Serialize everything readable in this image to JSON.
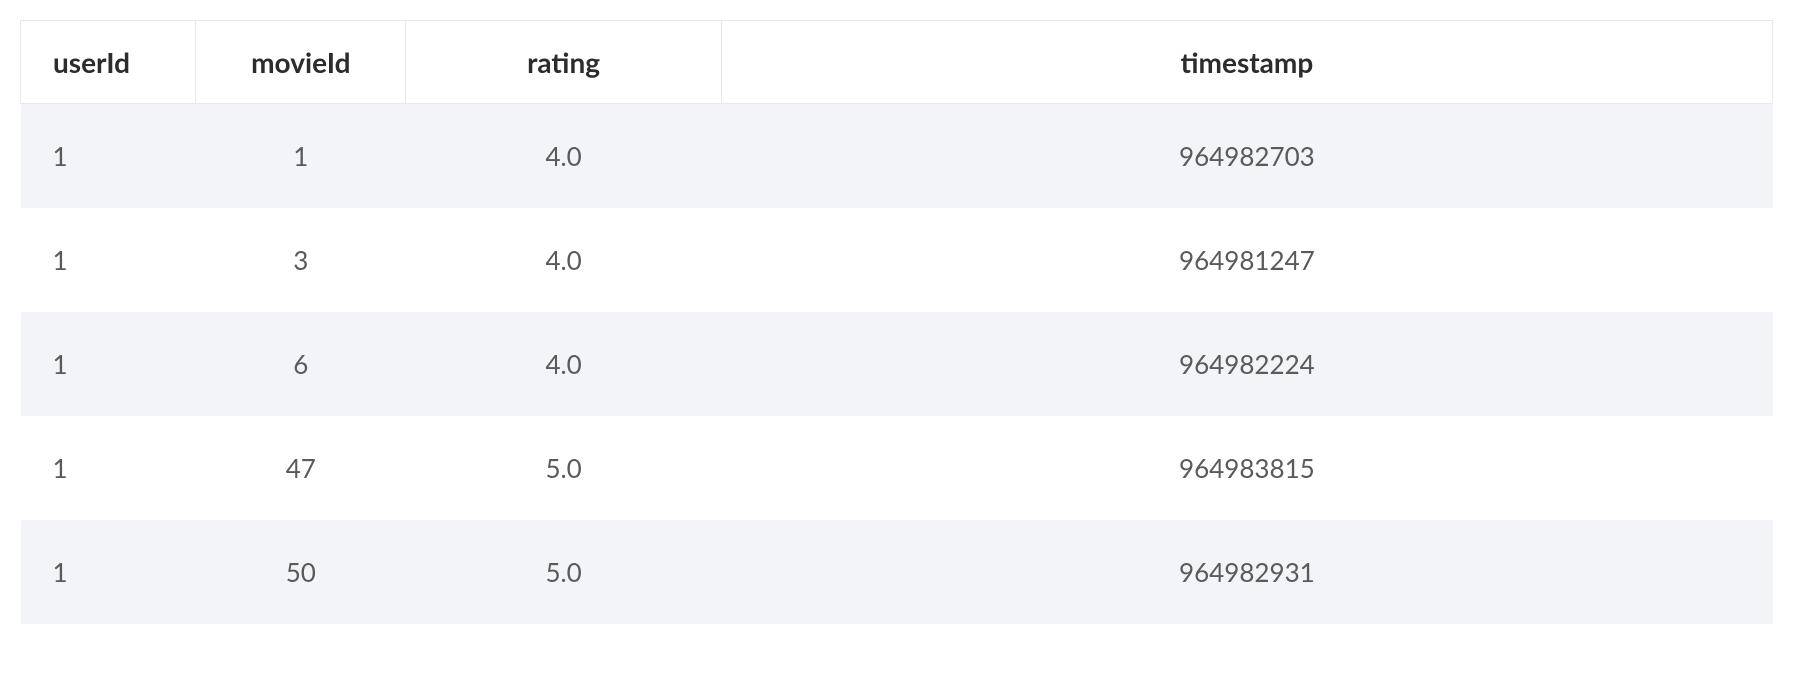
{
  "chart_data": {
    "type": "table",
    "columns": [
      "userId",
      "movieId",
      "rating",
      "timestamp"
    ],
    "rows": [
      {
        "userId": "1",
        "movieId": "1",
        "rating": "4.0",
        "timestamp": "964982703"
      },
      {
        "userId": "1",
        "movieId": "3",
        "rating": "4.0",
        "timestamp": "964981247"
      },
      {
        "userId": "1",
        "movieId": "6",
        "rating": "4.0",
        "timestamp": "964982224"
      },
      {
        "userId": "1",
        "movieId": "47",
        "rating": "5.0",
        "timestamp": "964983815"
      },
      {
        "userId": "1",
        "movieId": "50",
        "rating": "5.0",
        "timestamp": "964982931"
      }
    ]
  }
}
